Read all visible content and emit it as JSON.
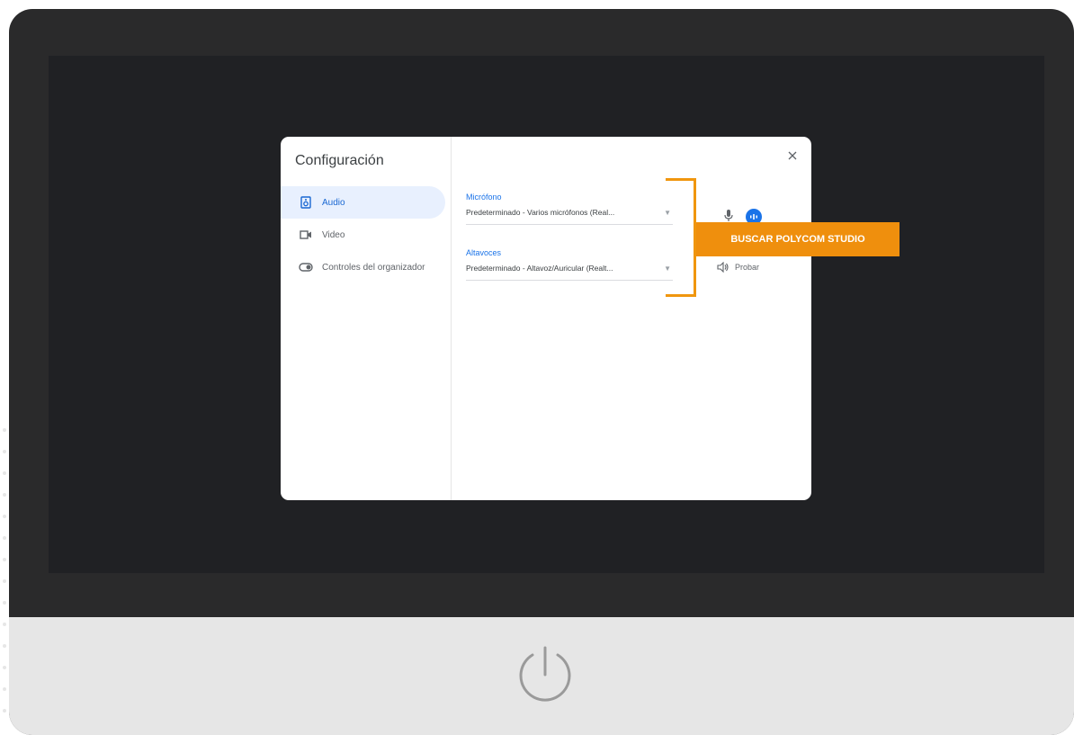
{
  "dialog": {
    "title": "Configuración",
    "close_icon": "close-icon",
    "nav": [
      {
        "label": "Audio",
        "icon": "speaker-icon",
        "active": true
      },
      {
        "label": "Video",
        "icon": "video-camera-icon",
        "active": false
      },
      {
        "label": "Controles del organizador",
        "icon": "toggle-icon",
        "active": false
      }
    ],
    "microphone": {
      "label": "Micrófono",
      "value": "Predeterminado - Varios micrófonos (Real..."
    },
    "speakers": {
      "label": "Altavoces",
      "value": "Predeterminado - Altavoz/Auricular (Realt...",
      "test_label": "Probar"
    }
  },
  "annotation": {
    "label": "BUSCAR POLYCOM STUDIO",
    "color": "#ef8f0d"
  },
  "colors": {
    "accent": "#1a73e8",
    "device_frame": "#2a2a2b",
    "screen": "#202124",
    "chin": "#e6e6e6"
  }
}
